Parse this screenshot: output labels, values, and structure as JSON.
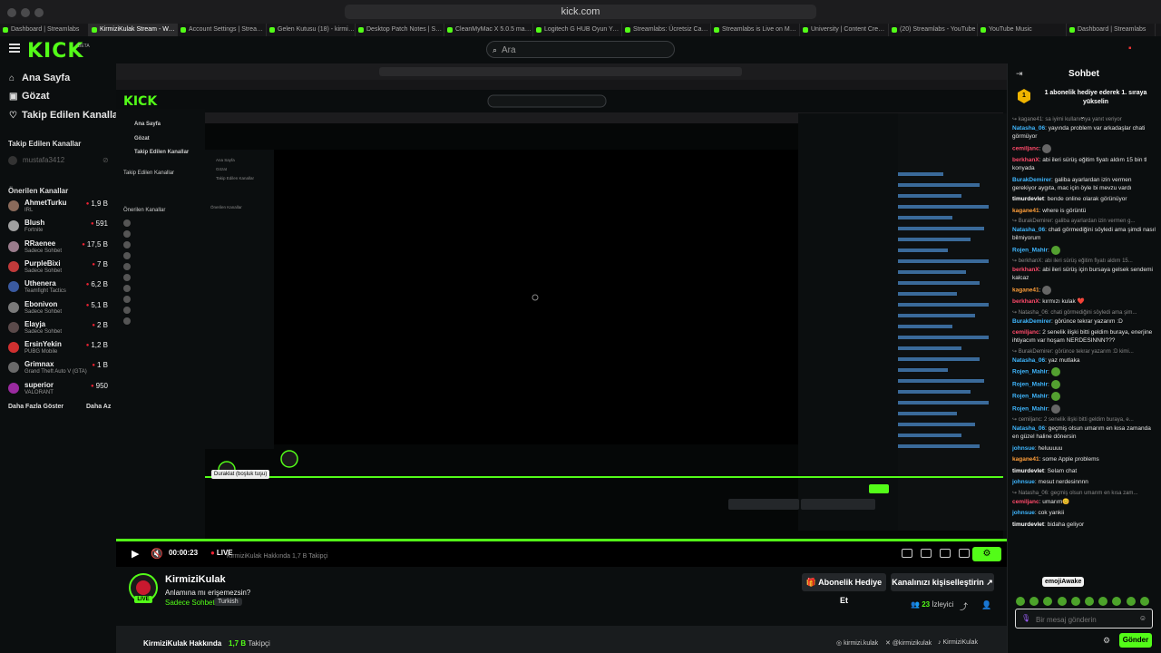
{
  "browser": {
    "url": "kick.com",
    "tabs": [
      "Dashboard | Streamlabs",
      "KirmiziKulak Stream - Wat...",
      "Account Settings | Stream...",
      "Gelen Kutusu (18) - kirmiz...",
      "Desktop Patch Notes | Str...",
      "CleanMyMac X 5.0.5 mac...",
      "Logitech G HUB Oyun Yaz...",
      "Streamlabs: Ücretsiz Canlı...",
      "Streamlabs is Live on Mac...",
      "University | Content Creati...",
      "(20) Streamlabs - YouTube",
      "YouTube Music",
      "Dashboard | Streamlabs"
    ]
  },
  "header": {
    "logo": "KICK",
    "logo_badge": "BETA",
    "search_placeholder": "Ara",
    "search_icon": "search-icon"
  },
  "sidebar": {
    "nav": [
      {
        "label": "Ana Sayfa",
        "icon": "home-icon"
      },
      {
        "label": "Gözat",
        "icon": "browse-icon"
      },
      {
        "label": "Takip Edilen Kanallar",
        "icon": "heart-icon"
      }
    ],
    "followed_heading": "Takip Edilen Kanallar",
    "followed_user": "mustafa3412",
    "recommended_heading": "Önerilen Kanallar",
    "channels": [
      {
        "name": "AhmetTurku",
        "category": "IRL",
        "viewers": "1,9 B",
        "color": "#8a6a5a"
      },
      {
        "name": "Blush",
        "category": "Fortnite",
        "viewers": "591",
        "color": "#a0a0a0"
      },
      {
        "name": "RRaenee",
        "category": "Sadece Sohbet",
        "viewers": "17,5 B",
        "color": "#9a7c8c"
      },
      {
        "name": "PurpleBixi",
        "category": "Sadece Sohbet",
        "viewers": "7 B",
        "color": "#c03a3a"
      },
      {
        "name": "Uthenera",
        "category": "Teamfight Tactics",
        "viewers": "6,2 B",
        "color": "#3a5aa0"
      },
      {
        "name": "Ebonivon",
        "category": "Sadece Sohbet",
        "viewers": "5,1 B",
        "color": "#7a7a7a"
      },
      {
        "name": "Elayja",
        "category": "Sadece Sohbet",
        "viewers": "2 B",
        "color": "#5a4a4a"
      },
      {
        "name": "ErsinYekin",
        "category": "PUBG Mobile",
        "viewers": "1,2 B",
        "color": "#d03030"
      },
      {
        "name": "Grimnax",
        "category": "Grand Theft Auto V (GTA)",
        "viewers": "1 B",
        "color": "#6a6a6a"
      },
      {
        "name": "superior",
        "category": "VALORANT",
        "viewers": "950",
        "color": "#9a2aa0"
      }
    ],
    "show_more": "Daha Fazla Göster",
    "show_less": "Daha Az"
  },
  "player": {
    "time": "00:00:23",
    "live": "LIVE",
    "about_overlay": "KirmiziKulak Hakkında",
    "followers_overlay": "1,7 B",
    "followers_overlay_label": "Takipçi",
    "pause_tooltip": "Duraklat (boşluk tuşu)"
  },
  "channel": {
    "name": "KirmiziKulak",
    "live_badge": "LIVE",
    "title": "Anlamına mı erişemezsin?",
    "category": "Sadece Sohbet",
    "language": "Turkish",
    "subscribe_label": "Abonelik Hediye Et",
    "customize_label": "Kanalınızı kişiselleştirin",
    "viewers": "23",
    "viewers_label": "İzleyici",
    "about_title": "KirmiziKulak Hakkında",
    "followers": "1,7 B",
    "followers_label": "Takipçi",
    "socials": [
      "kirmizi.kulak",
      "@kirmizikulak",
      "KirmiziKulak"
    ]
  },
  "chat": {
    "title": "Sohbet",
    "pinned_badge": "1",
    "pinned_text": "1 abonelik hediye ederek 1. sıraya yükselin",
    "messages": [
      {
        "reply": "kagane41: sa iyimi kullanıcıya yanıt veriyor",
        "user": "Natasha_06",
        "color": "#3fb7ff",
        "text": "yayında problem var arkadaşlar chati görmüyor"
      },
      {
        "user": "cemiljanc",
        "color": "#ff4a6a",
        "text": "",
        "emote": "dark"
      },
      {
        "user": "berkhanX",
        "color": "#ff4a6a",
        "text": "abi ileri sürüş eğitim fiyatı aldım 15 bin tl konyada"
      },
      {
        "user": "BurakDemirer",
        "color": "#3fb7ff",
        "text": "galiba ayarlardan izin vermen gerekiyor aygıta, mac için öyle bi mevzu vardı"
      },
      {
        "user": "timurdevlet",
        "color": "#ffffff",
        "text": "bende online olarak görünüyor"
      },
      {
        "user": "kagane41",
        "color": "#ff9e3a",
        "text": "where is görüntü"
      },
      {
        "reply": "BurakDemirer: galiba ayarlardan izin vermen g...",
        "user": "Natasha_06",
        "color": "#3fb7ff",
        "text": "chati görmediğini söyledi ama şimdi nasıl bilmiyorum"
      },
      {
        "user": "Rojen_Mahir",
        "color": "#3fb7ff",
        "text": "",
        "emote": "green"
      },
      {
        "reply": "berkhanX: abi ileri sürüş eğitim fiyatı aldım 15...",
        "user": "berkhanX",
        "color": "#ff4a6a",
        "text": "abi ileri sürüş için bursaya gelsek sendemi kalcaz"
      },
      {
        "user": "kagane41",
        "color": "#ff9e3a",
        "text": "",
        "emote": "dark"
      },
      {
        "user": "berkhanX",
        "color": "#ff4a6a",
        "text": "kırmızı kulak ❤️"
      },
      {
        "reply": "Natasha_06: chati görmediğini söyledi ama şim...",
        "user": "BurakDemirer",
        "color": "#3fb7ff",
        "text": "görünce tekrar yazarım :D"
      },
      {
        "user": "cemiljanc",
        "color": "#ff4a6a",
        "text": "2 senelik ilişki bitti geldim buraya, enerjine ihtiyacım var hoşam NERDESINNN???"
      },
      {
        "reply": "BurakDemirer: görünce tekrar yazarım :D kimi...",
        "user": "Natasha_06",
        "color": "#3fb7ff",
        "text": "yaz mutlaka"
      },
      {
        "user": "Rojen_Mahir",
        "color": "#3fb7ff",
        "text": "",
        "emote": "green"
      },
      {
        "user": "Rojen_Mahir",
        "color": "#3fb7ff",
        "text": "",
        "emote": "green"
      },
      {
        "user": "Rojen_Mahir",
        "color": "#3fb7ff",
        "text": "",
        "emote": "green"
      },
      {
        "user": "Rojen_Mahir",
        "color": "#3fb7ff",
        "text": "",
        "emote": "dark"
      },
      {
        "reply": "cemiljanc: 2 senelik ilişki bitti geldim buraya, e...",
        "user": "Natasha_06",
        "color": "#3fb7ff",
        "text": "geçmiş olsun umarım en kısa zamanda en güzel haline dönersin"
      },
      {
        "user": "johnsue",
        "color": "#3fb7ff",
        "text": "heluuuuu"
      },
      {
        "user": "kagane41",
        "color": "#ff9e3a",
        "text": "some Apple problems"
      },
      {
        "user": "timurdevlet",
        "color": "#ffffff",
        "text": "Selam chat"
      },
      {
        "user": "johnsue",
        "color": "#3fb7ff",
        "text": "mesut nerdesinnnn"
      },
      {
        "reply": "Natasha_06: geçmiş olsun umarım en kısa zam...",
        "user": "cemiljanc",
        "color": "#ff4a6a",
        "text": "umarım😊"
      },
      {
        "user": "johnsue",
        "color": "#3fb7ff",
        "text": "cok yankii"
      },
      {
        "user": "timurdevlet",
        "color": "#ffffff",
        "text": "bidaha geliyor"
      }
    ],
    "emote_tooltip": "emojiAwake",
    "input_placeholder": "Bir mesaj gönderin",
    "send_label": "Gönder"
  },
  "colors": {
    "accent": "#53fc18",
    "background": "#0b0e0f",
    "live": "#e2263a"
  }
}
